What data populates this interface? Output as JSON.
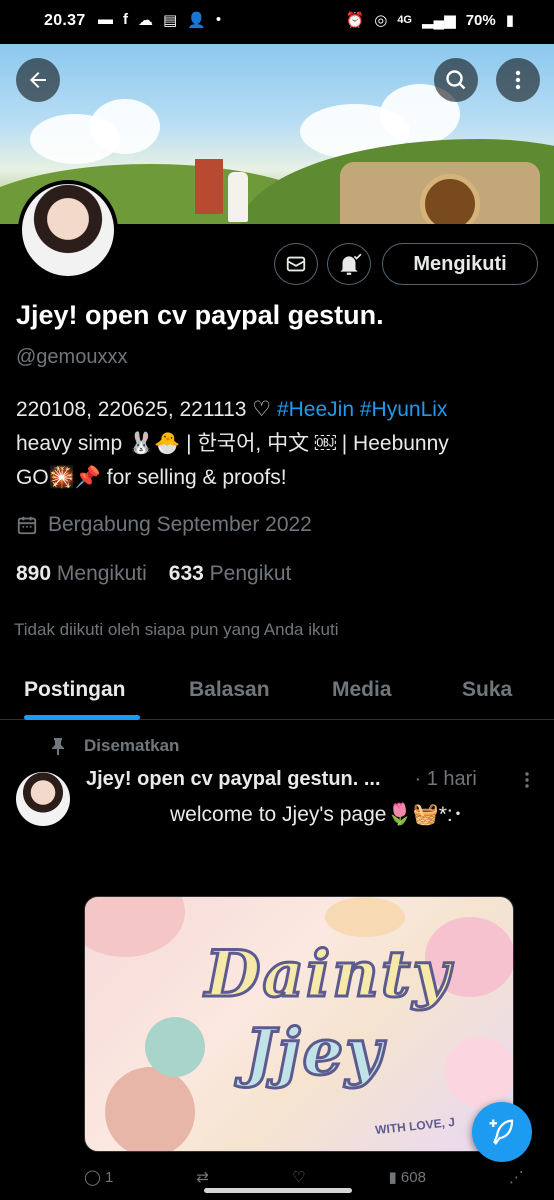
{
  "status_bar": {
    "time": "20.37",
    "network": "4G",
    "battery": "70%"
  },
  "profile": {
    "name": "Jjey! open cv paypal gestun.",
    "handle": "@gemouxxx",
    "follow_button": "Mengikuti",
    "bio_line1_prefix": "220108, 220625, 221113 ♡ ",
    "bio_tag1": "#HeeJin",
    "bio_tag2": "#HyunLix",
    "bio_line2": "heavy simp 🐰🐣 | 한국어, 中文 ￼ | Heebunny",
    "bio_line3": "GO🎇📌 for selling & proofs!",
    "joined": "Bergabung September 2022",
    "following_count": "890",
    "following_label": "Mengikuti",
    "followers_count": "633",
    "followers_label": "Pengikut",
    "not_followed_note": "Tidak diikuti oleh siapa pun yang Anda ikuti"
  },
  "tabs": [
    {
      "label": "Postingan",
      "active": true
    },
    {
      "label": "Balasan",
      "active": false
    },
    {
      "label": "Media",
      "active": false
    },
    {
      "label": "Suka",
      "active": false
    }
  ],
  "pinned_post": {
    "pinned_label": "Disematkan",
    "author": "Jjey! open cv paypal gestun. ...",
    "time": "· 1 hari",
    "text": "welcome to Jjey's page🌷🧺*:･",
    "image_title_line1": "Dainty",
    "image_title_line2": "Jjey",
    "image_footer": "WITH LOVE, J",
    "reply_count": "1",
    "view_count": "608"
  },
  "colors": {
    "accent": "#1d9bf0",
    "muted": "#71767b",
    "text": "#e7e9ea",
    "background": "#000000"
  }
}
